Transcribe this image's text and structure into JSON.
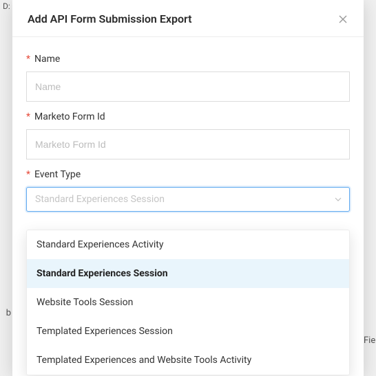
{
  "background": {
    "topLeftFragment": "D:",
    "leftFragment": "b",
    "rightFragment": "Fie"
  },
  "modal": {
    "title": "Add API Form Submission Export",
    "fields": {
      "name": {
        "label": "Name",
        "placeholder": "Name",
        "value": ""
      },
      "marketoFormId": {
        "label": "Marketo Form Id",
        "placeholder": "Marketo Form Id",
        "value": ""
      },
      "eventType": {
        "label": "Event Type",
        "placeholder": "Standard Experiences Session",
        "selected": "Standard Experiences Session",
        "options": [
          "Standard Experiences Activity",
          "Standard Experiences Session",
          "Website Tools Session",
          "Templated Experiences Session",
          "Templated Experiences and Website Tools Activity"
        ]
      }
    }
  }
}
